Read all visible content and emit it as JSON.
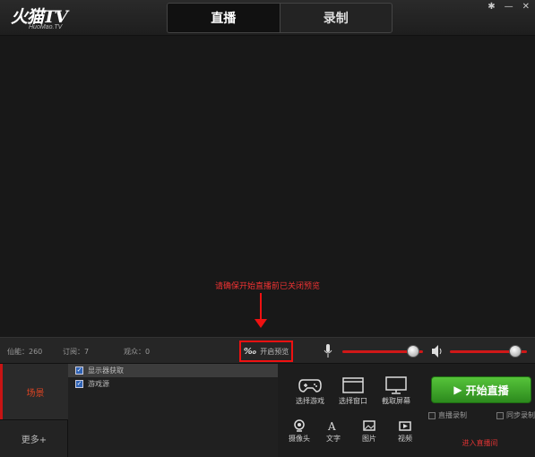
{
  "header": {
    "logo_title": "火猫TV",
    "logo_subtitle": "HuoMao.TV",
    "tabs": [
      {
        "label": "直播",
        "active": true
      },
      {
        "label": "录制",
        "active": false
      }
    ],
    "settings_icon": "gear-icon",
    "minimize_icon": "minimize-icon",
    "close_icon": "close-icon"
  },
  "preview": {
    "notice": "请确保开始直播前已关闭预览"
  },
  "status": {
    "fans": "仙能：260",
    "subscriptions": "订阅：7",
    "viewers": "观众：0",
    "preview_toggle_label": "开启预览",
    "mic_level": 0.88,
    "speaker_level": 0.85
  },
  "scenes": {
    "scene_tab_label": "场景",
    "more_label": "更多+",
    "sources": [
      {
        "label": "显示器获取",
        "checked": true
      },
      {
        "label": "游戏源",
        "checked": true
      }
    ]
  },
  "tools": {
    "select_game": "选择游戏",
    "select_window": "选择窗口",
    "capture_screen": "截取屏幕",
    "camera": "摄像头",
    "text": "文字",
    "image": "图片",
    "video": "视频"
  },
  "live": {
    "start_label": "开始直播",
    "option_1": "直播录制",
    "option_2": "同步录制",
    "enter_room": "进入直播间"
  },
  "colors": {
    "accent_red": "#d01818",
    "live_green": "#3fa52a"
  }
}
